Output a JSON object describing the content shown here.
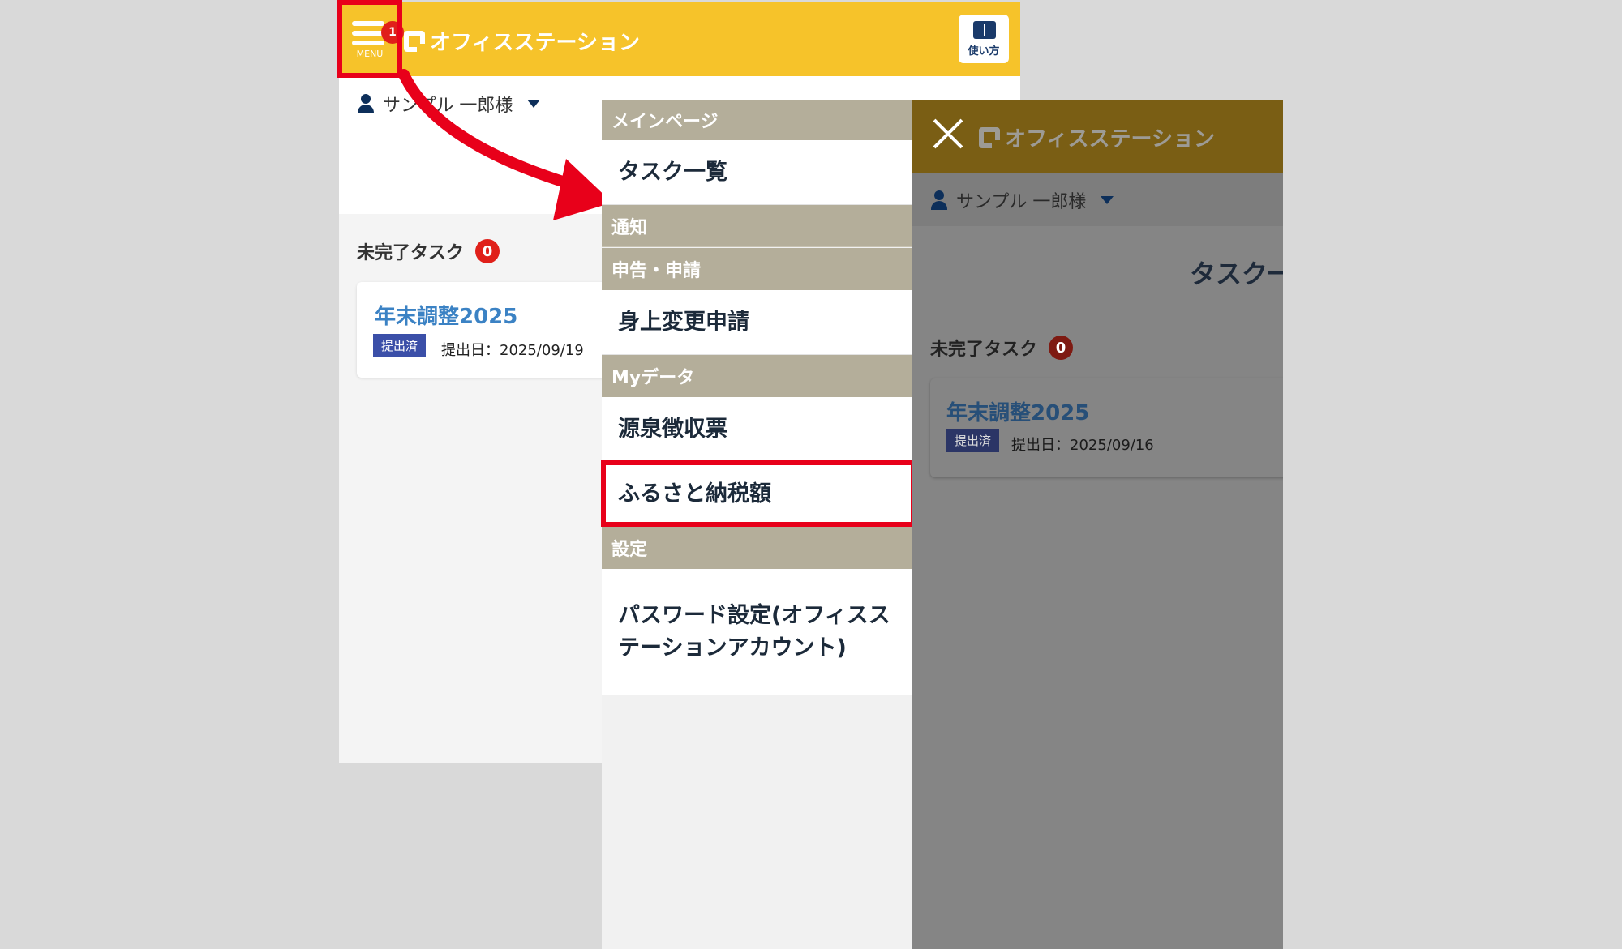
{
  "app": {
    "name": "オフィスステーション",
    "menu_label": "MENU",
    "menu_badge": "1",
    "guide_label": "使い方"
  },
  "user": {
    "name": "サンプル 一郎様"
  },
  "tasks": {
    "section_label": "未完了タスク",
    "count": "0",
    "page_heading_partial": "タスク一",
    "items_left": [
      {
        "title": "年末調整2025",
        "status": "提出済",
        "submitted": "提出日：2025/09/19"
      }
    ],
    "items_right": [
      {
        "title": "年末調整2025",
        "status": "提出済",
        "submitted": "提出日：2025/09/16"
      }
    ]
  },
  "menu": {
    "sections": [
      {
        "header": "メインページ",
        "items": [
          "タスク一覧"
        ]
      },
      {
        "header": "通知",
        "items": []
      },
      {
        "header": "申告・申請",
        "items": [
          "身上変更申請"
        ]
      },
      {
        "header": "Myデータ",
        "items": [
          "源泉徴収票",
          "ふるさと納税額"
        ]
      },
      {
        "header": "設定",
        "items": [
          "パスワード設定(オフィスステーションアカウント)"
        ]
      }
    ],
    "highlighted_item": "ふるさと納税額"
  },
  "colors": {
    "header_yellow": "#f6c32a",
    "menu_section_bg": "#b4ae9a",
    "highlight_red": "#e8001a",
    "badge_red": "#e0201a",
    "link_blue": "#3b82c4",
    "status_tag_blue": "#3b4fa8"
  },
  "icons": [
    "hamburger-menu-icon",
    "logo-icon",
    "book-icon",
    "user-icon",
    "caret-down-icon",
    "close-icon",
    "arrow-annotation"
  ]
}
